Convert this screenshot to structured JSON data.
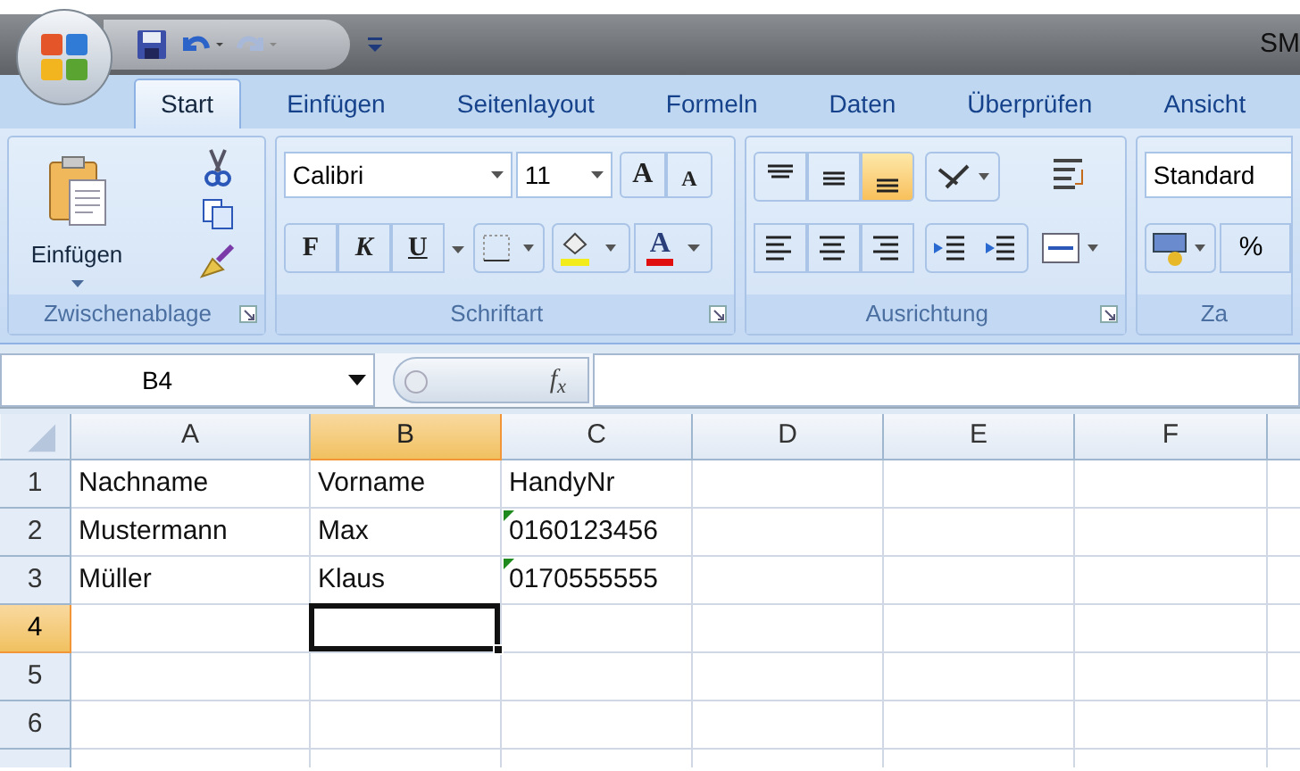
{
  "title_bar": {
    "title": "SM"
  },
  "tabs": [
    {
      "label": "Start",
      "selected": true
    },
    {
      "label": "Einfügen",
      "selected": false
    },
    {
      "label": "Seitenlayout",
      "selected": false
    },
    {
      "label": "Formeln",
      "selected": false
    },
    {
      "label": "Daten",
      "selected": false
    },
    {
      "label": "Überprüfen",
      "selected": false
    },
    {
      "label": "Ansicht",
      "selected": false
    }
  ],
  "ribbon": {
    "clipboard": {
      "paste_label": "Einfügen",
      "group_label": "Zwischenablage"
    },
    "font": {
      "family": "Calibri",
      "size": "11",
      "grow": "A",
      "shrink": "A",
      "bold": "F",
      "italic": "K",
      "underline": "U",
      "color_letter": "A",
      "group_label": "Schriftart"
    },
    "alignment": {
      "vertical": [
        {
          "kind": "top",
          "selected": false
        },
        {
          "kind": "middle",
          "selected": false
        },
        {
          "kind": "bottom",
          "selected": true
        }
      ],
      "group_label": "Ausrichtung"
    },
    "number": {
      "format": "Standard",
      "percent": "%",
      "group_label": "Za"
    }
  },
  "formula_bar": {
    "name_box": "B4",
    "fx": "f$_{x}$"
  },
  "sheet": {
    "columns": [
      {
        "label": "A",
        "selected": false
      },
      {
        "label": "B",
        "selected": true
      },
      {
        "label": "C",
        "selected": false
      },
      {
        "label": "D",
        "selected": false
      },
      {
        "label": "E",
        "selected": false
      },
      {
        "label": "F",
        "selected": false
      }
    ],
    "rows": [
      {
        "header": "1",
        "selected": false,
        "cells": [
          {
            "text": "Nachname",
            "selected": false
          },
          {
            "text": "Vorname",
            "selected": false
          },
          {
            "text": "HandyNr",
            "selected": false
          },
          {
            "selected": false
          },
          {
            "selected": false
          },
          {
            "selected": false
          }
        ]
      },
      {
        "header": "2",
        "selected": false,
        "cells": [
          {
            "text": "Mustermann",
            "selected": false
          },
          {
            "text": "Max",
            "selected": false
          },
          {
            "text": "0160123456",
            "flagged": true,
            "selected": false
          },
          {
            "selected": false
          },
          {
            "selected": false
          },
          {
            "selected": false
          }
        ]
      },
      {
        "header": "3",
        "selected": false,
        "cells": [
          {
            "text": "Müller",
            "selected": false
          },
          {
            "text": "Klaus",
            "selected": false
          },
          {
            "text": "0170555555",
            "flagged": true,
            "selected": false
          },
          {
            "selected": false
          },
          {
            "selected": false
          },
          {
            "selected": false
          }
        ]
      },
      {
        "header": "4",
        "selected": true,
        "cells": [
          {
            "selected": false
          },
          {
            "selected": true
          },
          {
            "selected": false
          },
          {
            "selected": false
          },
          {
            "selected": false
          },
          {
            "selected": false
          }
        ]
      },
      {
        "header": "5",
        "selected": false,
        "cells": [
          {
            "selected": false
          },
          {
            "selected": false
          },
          {
            "selected": false
          },
          {
            "selected": false
          },
          {
            "selected": false
          },
          {
            "selected": false
          }
        ]
      },
      {
        "header": "6",
        "selected": false,
        "cells": [
          {
            "selected": false
          },
          {
            "selected": false
          },
          {
            "selected": false
          },
          {
            "selected": false
          },
          {
            "selected": false
          },
          {
            "selected": false
          }
        ]
      }
    ]
  }
}
